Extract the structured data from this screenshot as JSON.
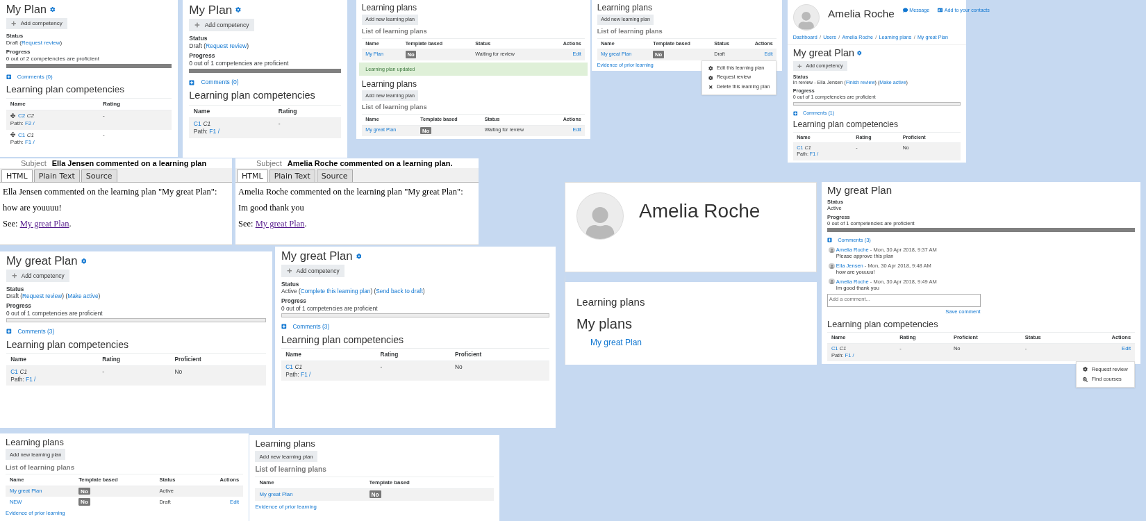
{
  "panels": [
    {
      "sections": [
        {
          "kind": "plan",
          "title": "My Plan",
          "add_button": "Add competency",
          "status_label": "Status",
          "status": [
            {
              "kind": "text",
              "text": "Draft ("
            },
            {
              "kind": "link",
              "text": "Request review"
            },
            {
              "kind": "text",
              "text": ")"
            }
          ],
          "progress_label": "Progress",
          "progress_text": "0 out of 2 competencies are proficient",
          "level": 0,
          "comments_link": "Comments (0)",
          "heading": "Learning plan competencies",
          "columns": [
            "Name",
            "Rating"
          ],
          "rows": [
            {
              "cells": [
                {
                  "kind": "competency",
                  "code": "C2",
                  "name": "C2",
                  "path_label": "Path:",
                  "path": "F2 /"
                },
                {
                  "kind": "text",
                  "text": "-"
                }
              ]
            },
            {
              "cells": [
                {
                  "kind": "competency",
                  "code": "C1",
                  "name": "C1",
                  "path_label": "Path:",
                  "path": "F1 /"
                },
                {
                  "kind": "text",
                  "text": "-"
                }
              ]
            }
          ]
        }
      ]
    },
    {
      "sections": [
        {
          "kind": "plan",
          "title": "My Plan",
          "add_button": "Add competency",
          "status_label": "Status",
          "status": [
            {
              "kind": "text",
              "text": "Draft ("
            },
            {
              "kind": "link",
              "text": "Request review"
            },
            {
              "kind": "text",
              "text": ")"
            }
          ],
          "progress_label": "Progress",
          "progress_text": "0 out of 1 competencies are proficient",
          "level": 0,
          "comments_link": "Comments (0)",
          "heading": "Learning plan competencies",
          "columns": [
            "Name",
            "Rating"
          ],
          "rows": [
            {
              "cells": [
                {
                  "kind": "competency",
                  "code": "C1",
                  "name": "C1",
                  "path_label": "Path:",
                  "path": "F1 /"
                },
                {
                  "kind": "text",
                  "text": "-"
                }
              ]
            }
          ]
        }
      ]
    },
    {
      "sections": [
        {
          "kind": "plans_list",
          "title": "Learning plans",
          "add_button": "Add new learning plan",
          "subheading": "List of learning plans",
          "columns": [
            "Name",
            "Template based",
            "Status",
            "Actions"
          ],
          "rows": [
            {
              "cells": [
                {
                  "kind": "link",
                  "text": "My Plan"
                },
                {
                  "kind": "badge",
                  "text": "No"
                },
                {
                  "kind": "text",
                  "text": "Waiting for review"
                },
                {
                  "kind": "action",
                  "text": "Edit"
                }
              ]
            }
          ]
        },
        {
          "kind": "alert",
          "text": "Learning plan updated"
        },
        {
          "kind": "plans_list",
          "title": "Learning plans",
          "add_button": "Add new learning plan",
          "subheading": "List of learning plans",
          "columns": [
            "Name",
            "Template based",
            "Status",
            "Actions"
          ],
          "rows": [
            {
              "cells": [
                {
                  "kind": "link",
                  "text": "My great Plan"
                },
                {
                  "kind": "badge",
                  "text": "No"
                },
                {
                  "kind": "text",
                  "text": "Waiting for review"
                },
                {
                  "kind": "action",
                  "text": "Edit"
                }
              ]
            }
          ]
        }
      ]
    },
    {
      "sections": [
        {
          "kind": "plans_list",
          "title": "Learning plans",
          "add_button": "Add new learning plan",
          "subheading": "List of learning plans",
          "columns": [
            "Name",
            "Template based",
            "Status",
            "Actions"
          ],
          "rows": [
            {
              "cells": [
                {
                  "kind": "link",
                  "text": "My great Plan"
                },
                {
                  "kind": "badge",
                  "text": "No"
                },
                {
                  "kind": "text",
                  "text": "Draft"
                },
                {
                  "kind": "action",
                  "text": "Edit",
                  "menu": [
                    "Edit this learning plan",
                    "Request review",
                    "Delete this learning plan"
                  ]
                }
              ]
            }
          ],
          "footer_link": "Evidence of prior learning"
        }
      ]
    },
    {
      "sections": [
        {
          "kind": "profile",
          "name": "Amelia Roche",
          "links": [
            "Message",
            "Add to your contacts"
          ],
          "breadcrumbs": [
            {
              "kind": "link",
              "text": "Dashboard"
            },
            {
              "kind": "separator",
              "text": "/"
            },
            {
              "kind": "link",
              "text": "Users"
            },
            {
              "kind": "separator",
              "text": "/"
            },
            {
              "kind": "link",
              "text": "Amelia Roche"
            },
            {
              "kind": "separator",
              "text": "/"
            },
            {
              "kind": "link",
              "text": "Learning plans"
            },
            {
              "kind": "separator",
              "text": "/"
            },
            {
              "kind": "link",
              "text": "My great Plan"
            }
          ]
        },
        {
          "kind": "plan",
          "title": "My great Plan",
          "add_button": "Add competency",
          "status_label": "Status",
          "status": [
            {
              "kind": "text",
              "text": "In review - Ella Jensen ("
            },
            {
              "kind": "link",
              "text": "Finish review"
            },
            {
              "kind": "text",
              "text": ") ("
            },
            {
              "kind": "link",
              "text": "Make active"
            },
            {
              "kind": "text",
              "text": ")"
            }
          ],
          "progress_label": "Progress",
          "progress_text": "0 out of 1 competencies are proficient",
          "level": 0,
          "comments_link": "Comments (1)",
          "heading": "Learning plan competencies",
          "columns": [
            "Name",
            "Rating",
            "Proficient"
          ],
          "rows": [
            {
              "cells": [
                {
                  "kind": "competency",
                  "code": "C1",
                  "name": "C1",
                  "path_label": "Path:",
                  "path": "F1 /"
                },
                {
                  "kind": "text",
                  "text": "-"
                },
                {
                  "kind": "text",
                  "text": "No"
                }
              ]
            }
          ]
        }
      ]
    },
    {
      "sections": [
        {
          "kind": "email",
          "subject_label": "Subject",
          "subject": "Ella Jensen commented on a learning plan",
          "tabs": [
            {
              "label": "HTML",
              "selected": true
            },
            {
              "label": "Plain Text",
              "selected": false
            },
            {
              "label": "Source",
              "selected": false
            }
          ],
          "paragraphs": [
            [
              {
                "kind": "text",
                "text": "Ella Jensen commented on the learning plan \"My great Plan\":"
              }
            ],
            [
              {
                "kind": "text",
                "text": "how are youuuu!"
              }
            ],
            [
              {
                "kind": "text",
                "text": "See: "
              },
              {
                "kind": "link",
                "text": "My great Plan"
              },
              {
                "kind": "text",
                "text": "."
              }
            ]
          ]
        }
      ]
    },
    {
      "sections": [
        {
          "kind": "email",
          "subject_label": "Subject",
          "subject": "Amelia Roche commented on a learning plan.",
          "tabs": [
            {
              "label": "HTML",
              "selected": true
            },
            {
              "label": "Plain Text",
              "selected": false
            },
            {
              "label": "Source",
              "selected": false
            }
          ],
          "paragraphs": [
            [
              {
                "kind": "text",
                "text": "Amelia Roche commented on the learning plan \"My great Plan\":"
              }
            ],
            [
              {
                "kind": "text",
                "text": "Im good thank you"
              }
            ],
            [
              {
                "kind": "text",
                "text": "See: "
              },
              {
                "kind": "link",
                "text": "My great Plan"
              },
              {
                "kind": "text",
                "text": "."
              }
            ]
          ]
        }
      ]
    },
    {
      "sections": [
        {
          "kind": "plan",
          "title": "My great Plan",
          "add_button": "Add competency",
          "status_label": "Status",
          "status": [
            {
              "kind": "text",
              "text": "Draft ("
            },
            {
              "kind": "link",
              "text": "Request review"
            },
            {
              "kind": "text",
              "text": ") ("
            },
            {
              "kind": "link",
              "text": "Make active"
            },
            {
              "kind": "text",
              "text": ")"
            }
          ],
          "progress_label": "Progress",
          "progress_text": "0 out of 1 competencies are proficient",
          "level": 0,
          "comments_link": "Comments (3)",
          "heading": "Learning plan competencies",
          "columns": [
            "Name",
            "Rating",
            "Proficient"
          ],
          "rows": [
            {
              "cells": [
                {
                  "kind": "competency",
                  "code": "C1",
                  "name": "C1",
                  "path_label": "Path:",
                  "path": "F1 /"
                },
                {
                  "kind": "text",
                  "text": "-"
                },
                {
                  "kind": "text",
                  "text": "No"
                }
              ]
            }
          ]
        }
      ]
    },
    {
      "sections": [
        {
          "kind": "plan",
          "title": "My great Plan",
          "add_button": "Add competency",
          "status_label": "Status",
          "status": [
            {
              "kind": "text",
              "text": "Active ("
            },
            {
              "kind": "link",
              "text": "Complete this learning plan"
            },
            {
              "kind": "text",
              "text": ") ("
            },
            {
              "kind": "link",
              "text": "Send back to draft"
            },
            {
              "kind": "text",
              "text": ")"
            }
          ],
          "progress_label": "Progress",
          "progress_text": "0 out of 1 competencies are proficient",
          "level": 0,
          "comments_link": "Comments (3)",
          "heading": "Learning plan competencies",
          "columns": [
            "Name",
            "Rating",
            "Proficient"
          ],
          "rows": [
            {
              "cells": [
                {
                  "kind": "competency",
                  "code": "C1",
                  "name": "C1",
                  "path_label": "Path:",
                  "path": "F1 /"
                },
                {
                  "kind": "text",
                  "text": "-"
                },
                {
                  "kind": "text",
                  "text": "No"
                }
              ]
            }
          ]
        }
      ]
    },
    {
      "sections": [
        {
          "kind": "profile",
          "name": "Amelia Roche"
        },
        {
          "kind": "my_plans",
          "title": "Learning plans",
          "subheading": "My plans",
          "link": "My great Plan"
        }
      ]
    },
    {
      "sections": [
        {
          "kind": "plan",
          "title": "My great Plan",
          "status_label": "Status",
          "status": [
            {
              "kind": "text",
              "text": "Active"
            }
          ],
          "progress_label": "Progress",
          "progress_text": "0 out of 1 competencies are proficient",
          "level": 0,
          "comments_link": "Comments (3)",
          "comments": [
            {
              "author": "Amelia Roche",
              "date": " - Mon, 30 Apr 2018, 9:37 AM",
              "text": "Please approve this plan"
            },
            {
              "author": "Ella Jensen",
              "date": " - Mon, 30 Apr 2018, 9:48 AM",
              "text": "how are youuuu!"
            },
            {
              "author": "Amelia Roche",
              "date": " - Mon, 30 Apr 2018, 9:49 AM",
              "text": "Im good thank you"
            }
          ],
          "comment_placeholder": "Add a comment...",
          "save_link": "Save comment",
          "heading": "Learning plan competencies",
          "columns": [
            "Name",
            "Rating",
            "Proficient",
            "Status",
            "Actions"
          ],
          "rows": [
            {
              "cells": [
                {
                  "kind": "competency",
                  "code": "C1",
                  "name": "C1",
                  "path_label": "Path:",
                  "path": "F1 /"
                },
                {
                  "kind": "text",
                  "text": "-"
                },
                {
                  "kind": "text",
                  "text": "No"
                },
                {
                  "kind": "text",
                  "text": "-"
                },
                {
                  "kind": "action",
                  "text": "Edit",
                  "menu": [
                    "Request review",
                    "Find courses"
                  ]
                }
              ]
            }
          ]
        }
      ]
    },
    {
      "sections": [
        {
          "kind": "plans_list",
          "title": "Learning plans",
          "add_button": "Add new learning plan",
          "subheading": "List of learning plans",
          "columns": [
            "Name",
            "Template based",
            "Status",
            "Actions"
          ],
          "rows": [
            {
              "cells": [
                {
                  "kind": "link",
                  "text": "My great Plan"
                },
                {
                  "kind": "badge",
                  "text": "No"
                },
                {
                  "kind": "text",
                  "text": "Active"
                },
                {
                  "kind": "empty"
                }
              ]
            },
            {
              "cells": [
                {
                  "kind": "link",
                  "text": "NEW"
                },
                {
                  "kind": "badge",
                  "text": "No"
                },
                {
                  "kind": "text",
                  "text": "Draft"
                },
                {
                  "kind": "action",
                  "text": "Edit"
                }
              ]
            }
          ],
          "footer_link": "Evidence of prior learning"
        }
      ]
    },
    {
      "sections": [
        {
          "kind": "plans_list",
          "title": "Learning plans",
          "add_button": "Add new learning plan",
          "subheading": "List of learning plans",
          "columns": [
            "Name",
            "Template based"
          ],
          "rows": [
            {
              "cells": [
                {
                  "kind": "link",
                  "text": "My great Plan"
                },
                {
                  "kind": "badge",
                  "text": "No"
                }
              ]
            }
          ],
          "footer_link": "Evidence of prior learning"
        }
      ]
    }
  ]
}
